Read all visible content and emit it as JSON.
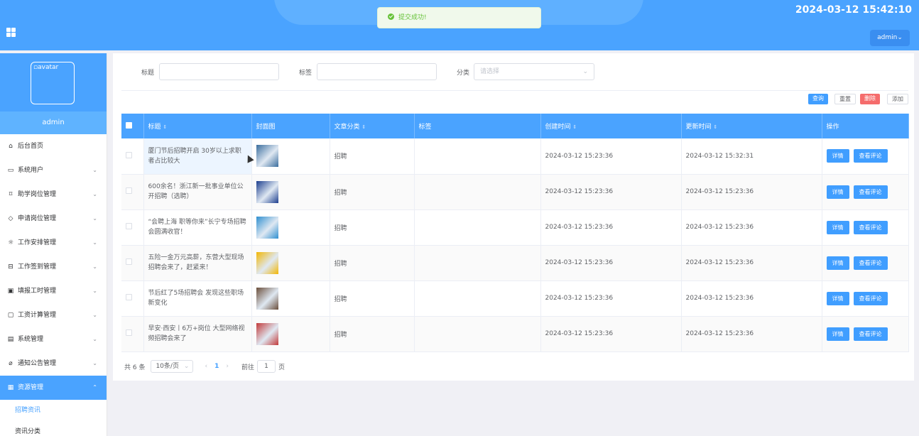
{
  "header": {
    "datetime": "2024-03-12 15:42:10",
    "user_button": "admin⌄"
  },
  "toast": {
    "message": "提交成功!"
  },
  "sidebar": {
    "avatar_alt": "avatar",
    "username": "admin",
    "items": [
      {
        "label": "后台首页",
        "icon": "home-icon",
        "glyph": "⌂",
        "has_children": false
      },
      {
        "label": "系统用户",
        "icon": "monitor-icon",
        "glyph": "▭",
        "has_children": true
      },
      {
        "label": "助学岗位管理",
        "icon": "bookmark-icon",
        "glyph": "⌑",
        "has_children": true
      },
      {
        "label": "申请岗位管理",
        "icon": "tag-icon",
        "glyph": "◇",
        "has_children": true
      },
      {
        "label": "工作安排管理",
        "icon": "sun-icon",
        "glyph": "☼",
        "has_children": true
      },
      {
        "label": "工作签到管理",
        "icon": "inbox-icon",
        "glyph": "⊟",
        "has_children": true
      },
      {
        "label": "填报工时管理",
        "icon": "clipboard-icon",
        "glyph": "▣",
        "has_children": true
      },
      {
        "label": "工资计算管理",
        "icon": "chat-icon",
        "glyph": "▢",
        "has_children": true
      },
      {
        "label": "系统管理",
        "icon": "box-icon",
        "glyph": "▤",
        "has_children": true
      },
      {
        "label": "通知公告管理",
        "icon": "paperclip-icon",
        "glyph": "⌀",
        "has_children": true
      },
      {
        "label": "资源管理",
        "icon": "files-icon",
        "glyph": "▦",
        "has_children": true,
        "active": true
      }
    ],
    "subitems": [
      {
        "label": "招聘资讯",
        "active": true
      },
      {
        "label": "资讯分类",
        "active": false
      }
    ],
    "chevron_down": "⌄",
    "chevron_up": "⌃"
  },
  "filters": {
    "title_label": "标题",
    "tag_label": "标签",
    "category_label": "分类",
    "category_placeholder": "请选择",
    "select_arrow": "⌄"
  },
  "toolbar": {
    "query": "查询",
    "reset": "重置",
    "delete": "删除",
    "add": "添加"
  },
  "table": {
    "columns": [
      "标题",
      "封面图",
      "文章分类",
      "标签",
      "创建时间",
      "更新时间",
      "操作"
    ],
    "sort_glyph": "⇕",
    "detail_label": "详情",
    "comment_label": "查看评论",
    "rows": [
      {
        "title": "厦门节后招聘开启 30岁以上求职者占比较大",
        "category": "招聘",
        "tag": "",
        "created": "2024-03-12 15:23:36",
        "updated": "2024-03-12 15:32:31",
        "thumb_color": "#3b6e9e"
      },
      {
        "title": "600余名！浙江新一批事业单位公开招聘（选聘）",
        "category": "招聘",
        "tag": "",
        "created": "2024-03-12 15:23:36",
        "updated": "2024-03-12 15:23:36",
        "thumb_color": "#1d3f8f"
      },
      {
        "title": "“会聘上海 职等你来”长宁专场招聘会圆满收官！",
        "category": "招聘",
        "tag": "",
        "created": "2024-03-12 15:23:36",
        "updated": "2024-03-12 15:23:36",
        "thumb_color": "#2f8fd0"
      },
      {
        "title": "五险一金万元高薪，东营大型现场招聘会来了，赶紧来！",
        "category": "招聘",
        "tag": "",
        "created": "2024-03-12 15:23:36",
        "updated": "2024-03-12 15:23:36",
        "thumb_color": "#f2b705"
      },
      {
        "title": "节后红了5场招聘会 发现这些职场新变化",
        "category": "招聘",
        "tag": "",
        "created": "2024-03-12 15:23:36",
        "updated": "2024-03-12 15:23:36",
        "thumb_color": "#6a4e3b"
      },
      {
        "title": "早安·西安丨6万+岗位 大型网络视频招聘会来了",
        "category": "招聘",
        "tag": "",
        "created": "2024-03-12 15:23:36",
        "updated": "2024-03-12 15:23:36",
        "thumb_color": "#c23b3b"
      }
    ]
  },
  "pagination": {
    "total_text": "共 6 条",
    "page_size": "10条/页",
    "prev": "‹",
    "current": "1",
    "next": "›",
    "goto_prefix": "前往",
    "goto_value": "1",
    "goto_suffix": "页"
  }
}
